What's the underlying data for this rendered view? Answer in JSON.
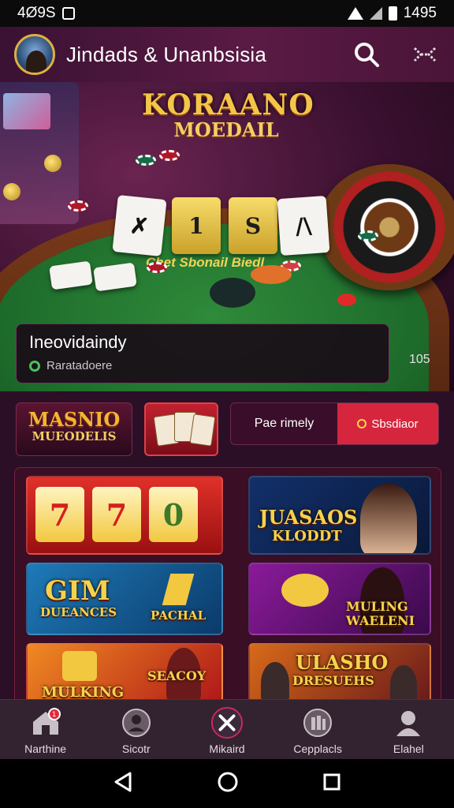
{
  "status_bar": {
    "time": "4Ø9S",
    "battery_time": "1495"
  },
  "header": {
    "title": "Jindads & Unanbsisia"
  },
  "hero": {
    "logo_line1": "KORAANO",
    "logo_line2": "MOEDAIL",
    "felt_label": "Chet Sbonail Biedl",
    "cards": [
      "✗",
      "1",
      "S",
      "/\\"
    ],
    "info_title": "Ineovidaindy",
    "info_subtitle": "Raratadoere",
    "count": "105"
  },
  "promo_row": {
    "logo_line1": "MASNIO",
    "logo_line2": "MUEODELIS",
    "segment_a": "Pae rimely",
    "segment_b": "Sbsdiaor"
  },
  "tiles": [
    {
      "name": "slot-770",
      "reels": [
        "7",
        "7",
        "0"
      ]
    },
    {
      "name": "gim-dueances",
      "line1": "GIM",
      "line2": "DUEANCES",
      "line3": "PACHAL"
    },
    {
      "name": "mulking-seacoy",
      "line1": "MULKING",
      "line2": "SEACOY"
    },
    {
      "name": "juasaos-kloddt",
      "line1": "JUASAOS",
      "line2": "KLODDT"
    },
    {
      "name": "muling-waeleni",
      "line1": "MULING",
      "line2": "WAELENI"
    },
    {
      "name": "ulasho-dresuehs",
      "line1": "ULASHO",
      "line2": "DRESUEHS"
    }
  ],
  "bottom_nav": [
    {
      "label": "Narthine"
    },
    {
      "label": "Sicotr"
    },
    {
      "label": "Mikaird"
    },
    {
      "label": "Cepplacls"
    },
    {
      "label": "Elahel"
    }
  ],
  "colors": {
    "accent": "#d6263e",
    "gold": "#f4c548",
    "background": "#2a0f26"
  }
}
